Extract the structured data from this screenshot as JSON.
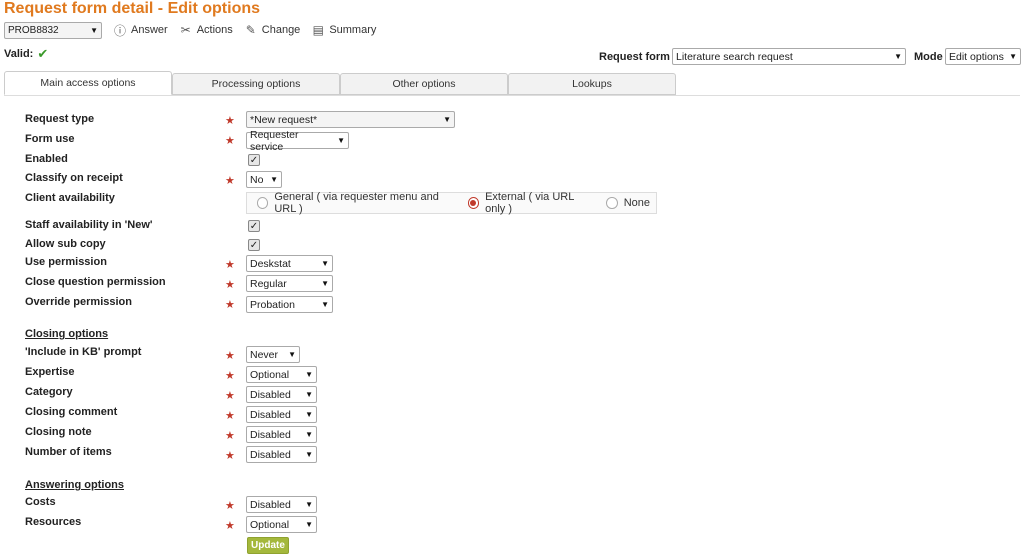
{
  "title": "Request form detail - Edit options",
  "toolbar": {
    "ref_value": "PROB8832",
    "answer": "Answer",
    "actions": "Actions",
    "change": "Change",
    "summary": "Summary"
  },
  "valid_label": "Valid:",
  "request_form": {
    "label": "Request form",
    "value": "Literature search request"
  },
  "mode": {
    "label": "Mode",
    "value": "Edit options"
  },
  "tabs": [
    "Main access options",
    "Processing options",
    "Other options",
    "Lookups"
  ],
  "fields": {
    "request_type": {
      "label": "Request type",
      "value": "*New request*"
    },
    "form_use": {
      "label": "Form use",
      "value": "Requester service"
    },
    "enabled": {
      "label": "Enabled"
    },
    "classify": {
      "label": "Classify on receipt",
      "value": "No"
    },
    "client_availability": {
      "label": "Client availability",
      "options": [
        "General ( via requester menu and URL )",
        "External ( via URL only )",
        "None"
      ],
      "selected": "External ( via URL only )"
    },
    "staff_new": {
      "label": "Staff availability in 'New'"
    },
    "sub_copy": {
      "label": "Allow sub copy"
    },
    "use_permission": {
      "label": "Use permission",
      "value": "Deskstat"
    },
    "close_permission": {
      "label": "Close question permission",
      "value": "Regular"
    },
    "override_permission": {
      "label": "Override permission",
      "value": "Probation"
    }
  },
  "closing": {
    "heading": "Closing options",
    "kb_prompt": {
      "label": "'Include in KB' prompt",
      "value": "Never"
    },
    "expertise": {
      "label": "Expertise",
      "value": "Optional"
    },
    "category": {
      "label": "Category",
      "value": "Disabled"
    },
    "closing_comment": {
      "label": "Closing comment",
      "value": "Disabled"
    },
    "closing_note": {
      "label": "Closing note",
      "value": "Disabled"
    },
    "number_items": {
      "label": "Number of items",
      "value": "Disabled"
    }
  },
  "answering": {
    "heading": "Answering options",
    "costs": {
      "label": "Costs",
      "value": "Disabled"
    },
    "resources": {
      "label": "Resources",
      "value": "Optional"
    }
  },
  "required_mark": "★",
  "update_label": "Update",
  "colors": {
    "title": "#e07a1f",
    "required": "#c0392b",
    "update_button": "#a4b83c",
    "valid_check": "#3a9a2a"
  }
}
